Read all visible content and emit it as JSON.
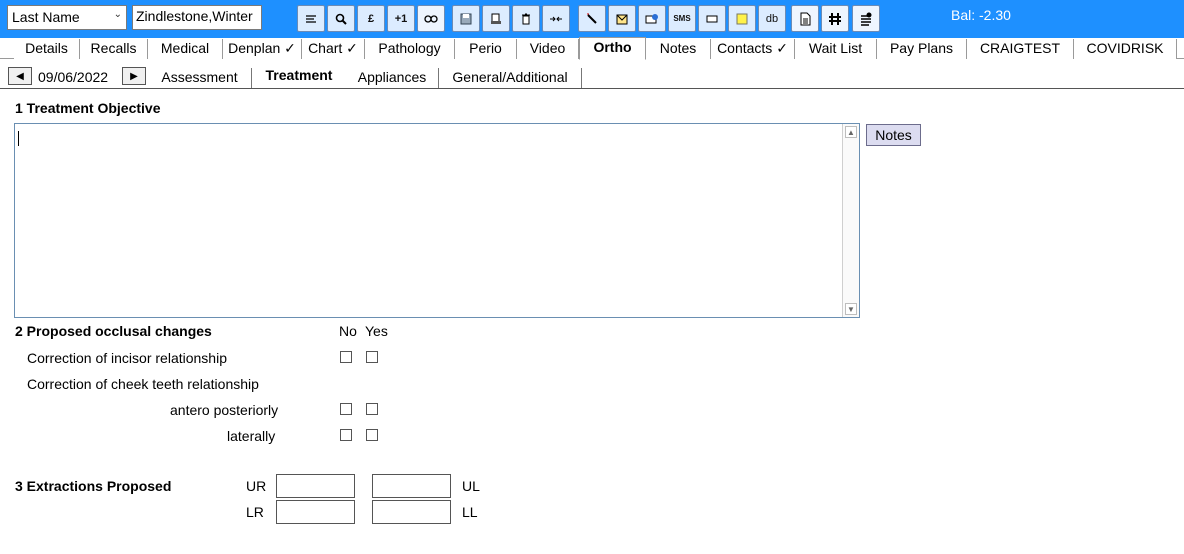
{
  "toolbar": {
    "search_field": "Last Name",
    "patient_name": "Zindlestone,Winter",
    "balance": "Bal: -2.30",
    "buttons": [
      {
        "name": "list-icon",
        "label": ""
      },
      {
        "name": "search-icon",
        "label": ""
      },
      {
        "name": "pound-icon",
        "label": "£"
      },
      {
        "name": "plus-one-icon",
        "label": "+1"
      },
      {
        "name": "link-icon",
        "label": ""
      },
      {
        "name": "save-icon",
        "label": ""
      },
      {
        "name": "print-icon",
        "label": ""
      },
      {
        "name": "delete-icon",
        "label": ""
      },
      {
        "name": "merge-icon",
        "label": ""
      },
      {
        "name": "pen-icon",
        "label": ""
      },
      {
        "name": "letter-icon",
        "label": ""
      },
      {
        "name": "email-icon",
        "label": ""
      },
      {
        "name": "sms-icon",
        "label": "SMS"
      },
      {
        "name": "card-icon",
        "label": ""
      },
      {
        "name": "sticky-note-icon",
        "label": ""
      },
      {
        "name": "database-icon",
        "label": "db"
      },
      {
        "name": "document-icon",
        "label": ""
      },
      {
        "name": "grid-icon",
        "label": ""
      },
      {
        "name": "cloud-list-icon",
        "label": ""
      }
    ]
  },
  "main_tabs": [
    {
      "label": "Details"
    },
    {
      "label": "Recalls"
    },
    {
      "label": "Medical"
    },
    {
      "label": "Denplan ✓"
    },
    {
      "label": "Chart ✓"
    },
    {
      "label": "Pathology"
    },
    {
      "label": "Perio"
    },
    {
      "label": "Video"
    },
    {
      "label": "Ortho"
    },
    {
      "label": "Notes"
    },
    {
      "label": "Contacts ✓"
    },
    {
      "label": "Wait List"
    },
    {
      "label": "Pay Plans"
    },
    {
      "label": "CRAIGTEST"
    },
    {
      "label": "COVIDRISK"
    }
  ],
  "sub_nav": {
    "date": "09/06/2022",
    "tabs": [
      {
        "label": "Assessment"
      },
      {
        "label": "Treatment"
      },
      {
        "label": "Appliances"
      },
      {
        "label": "General/Additional"
      }
    ]
  },
  "section1": {
    "title": "1 Treatment Objective",
    "text": "",
    "notes_button": "Notes"
  },
  "section2": {
    "title": "2 Proposed occlusal changes",
    "col_no": "No",
    "col_yes": "Yes",
    "rows": {
      "incisor": "Correction of incisor relationship",
      "cheek": "Correction of cheek teeth relationship",
      "antero": "antero posteriorly",
      "lateral": "laterally"
    }
  },
  "section3": {
    "title": "3 Extractions Proposed",
    "ur": "UR",
    "ul": "UL",
    "lr": "LR",
    "ll": "LL"
  }
}
